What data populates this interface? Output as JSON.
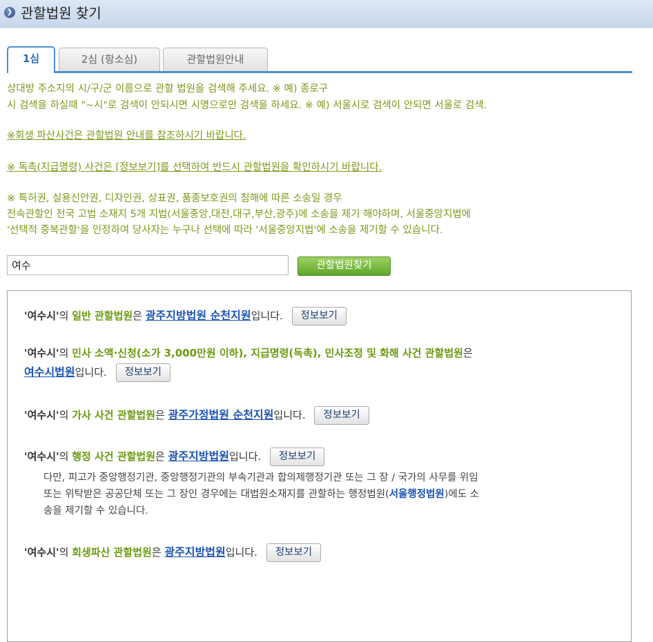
{
  "header": {
    "title": "관할법원 찾기"
  },
  "tabs": [
    {
      "label": "1심",
      "active": true
    },
    {
      "label": "2심 (항소심)",
      "active": false
    },
    {
      "label": "관할법원안내",
      "active": false
    }
  ],
  "notices": {
    "line1": "상대방 주소지의 시/구/군 이름으로 관할 법원을 검색해 주세요. ※ 예) 종로구",
    "line2": "시 검색을 하실때 \"~시\"로 검색이 안되시면 시명으로만 검색을 하세요. ※ 예) 서울시로 검색이 안되면 서울로 검색.",
    "line3": "※회생 파산사건은 관할법원 안내를 참조하시기 바랍니다.",
    "line4": "※ 독촉(지급명령) 사건은 [정보보기]를 선택하여 반드시 관할법원을 확인하시기 바랍니다.",
    "line5": "※ 특허권, 실용신안권, 디자인권, 상표권, 품종보호권의 침해에 따른 소송일 경우",
    "line6": "전속관할인 전국 고법 소재지 5개 지법(서울중앙,대전,대구,부산,광주)에 소송을 제기 해야하며, 서울중앙지법에",
    "line7": "'선택적 중복관할'을 인정하여 당사자는 누구나 선택에 따라 '서울중앙지법'에 소송을 제기할 수 있습니다."
  },
  "search": {
    "value": "여수",
    "button_label": "관할법원찾기"
  },
  "results": {
    "selected": "'여수시'",
    "particle": "의",
    "suffix": "입니다.",
    "info_label": "정보보기",
    "r1": {
      "kind": "일반 관할법원",
      "mid": "은",
      "court": "광주지방법원 순천지원"
    },
    "r2": {
      "kind": "민사 소액·신청(소가 3,000만원 이하), 지급명령(독촉), 민사조정 및 화해 사건 관할법원",
      "mid": "은",
      "court": "여수시법원"
    },
    "r3": {
      "kind": "가사 사건 관할법원",
      "mid": "은",
      "court": "광주가정법원 순천지원"
    },
    "r4": {
      "kind": "행정 사건 관할법원",
      "mid": "은",
      "court": "광주지방법원",
      "note1": "다만, 피고가 중앙행정기관, 중앙행정기관의 부속기관과 합의제행정기관 또는 그 장 / 국가의 사무를 위임",
      "note2a": "또는 위탁받은 공공단체 또는 그 장인 경우에는 대법원소재지를 관할하는 행정법원(",
      "note2b": "서울행정법원",
      "note2c": ")에도 소",
      "note3": "송을 제기할 수 있습니다."
    },
    "r5": {
      "kind": "회생파산 관할법원",
      "mid": "은",
      "court": "광주지방법원"
    }
  }
}
